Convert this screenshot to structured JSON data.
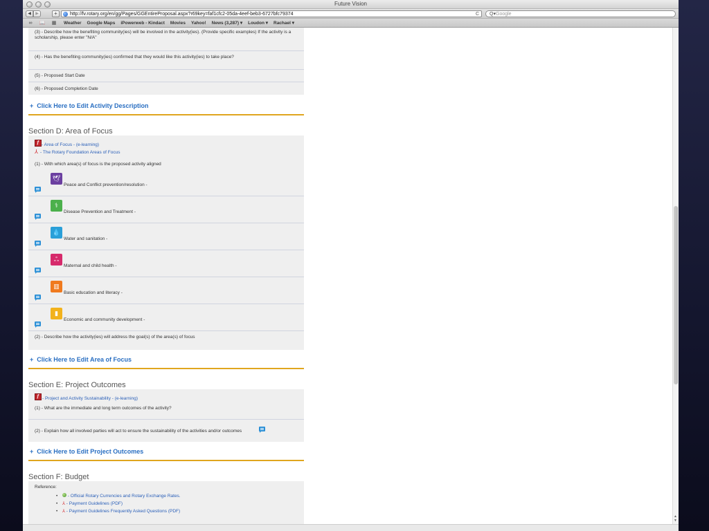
{
  "window": {
    "title": "Future Vision"
  },
  "toolbar": {
    "back": "◀",
    "forward": "▶",
    "add": "+",
    "url": "http://fv.rotary.org/en/gg/Pages/GGEntireProposal.aspx?r69key=faf1cfc2-05da-4eef-beb3-6727bfc79374",
    "reload": "C",
    "search_icon": "Q▾",
    "search_placeholder": "Google"
  },
  "bookmarks": {
    "icons": [
      "∞",
      "📖",
      "▦"
    ],
    "items": [
      "Weather",
      "Google Maps",
      "iPowerweb - Kindact",
      "Movies",
      "Yahoo!",
      "News (3,287) ▾",
      "Loudon ▾",
      "Rachael ▾"
    ]
  },
  "activity": {
    "q3": "(3) - Describe how the benefiting community(ies) will be involved in the activity(ies). (Provide specific examples) If the activity is a scholarship, please enter \"N/A\"",
    "q4": "(4) - Has the benefiting community(ies) confirmed that they would like this activity(ies) to take place?",
    "q5": "(5) - Proposed Start Date",
    "q6": "(6) - Proposed Completion Date",
    "edit": "Click Here to Edit Activity Description"
  },
  "area_of_focus": {
    "title": "Section D: Area of Focus",
    "link_elearning": " - Area of Focus - (e-learning)",
    "link_pdf": " - The Rotary Foundation Areas of Focus",
    "q1": "(1) - With which area(s) of focus is the proposed activity aligned",
    "items": [
      {
        "label": "Peace and Conflict prevention/resolution -",
        "icon": "dove-icon",
        "color": "#6b3fa0"
      },
      {
        "label": "Disease Prevention and Treatment -",
        "icon": "stethoscope-icon",
        "color": "#4bb04b"
      },
      {
        "label": "Water and sanitation -",
        "icon": "water-drop-icon",
        "color": "#2a9fd8"
      },
      {
        "label": "Maternal and child health -",
        "icon": "mother-child-icon",
        "color": "#d62a6b"
      },
      {
        "label": "Basic education and literacy -",
        "icon": "book-icon",
        "color": "#f07a1e"
      },
      {
        "label": "Economic and community development -",
        "icon": "bar-chart-icon",
        "color": "#f2b21c"
      }
    ],
    "q2": "(2) - Describe how the activity(ies) will address the goal(s) of the area(s) of focus",
    "edit": "Click Here to Edit Area of Focus"
  },
  "outcomes": {
    "title": "Section E: Project Outcomes",
    "link": "- Project and Activity Sustainability - (e-learning)",
    "q1": "(1) - What are the immediate and long term outcomes of the activity?",
    "q2": "(2) - Explain how all involved parties will act to ensure the sustainability of the activities and/or outcomes",
    "edit": "Click Here to Edit Project Outcomes"
  },
  "budget": {
    "title": "Section F: Budget",
    "reference": "Reference:",
    "refs": [
      " - Official Rotary Currencies and Rotary Exchange Rates.",
      " - Payment Guidelines (PDF)",
      " - Payment Guidelines Frequently Asked Questions (PDF)"
    ]
  },
  "glyphs": {
    "plus": "+",
    "pdf": "⅄",
    "flash": "ƒ"
  }
}
